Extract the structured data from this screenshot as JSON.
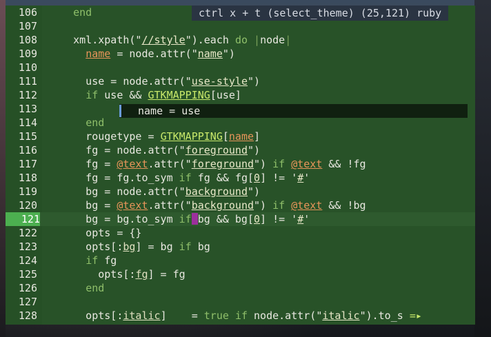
{
  "status": {
    "text": "ctrl x + t (select_theme) (25,121) ruby"
  },
  "popup": {
    "text": "name = use"
  },
  "truncation_marker": "=▸",
  "current_line": 121,
  "colors": {
    "editor_bg": "#285228",
    "current_line_bg": "#2e5a2e",
    "current_line_number_bg": "#4caf50",
    "cursor": "#9c2f9c",
    "status_bg": "#2a3442",
    "popup_bg": "#102010"
  },
  "lines": [
    {
      "n": "106",
      "t": "    end"
    },
    {
      "n": "107",
      "t": ""
    },
    {
      "n": "108",
      "t": "    xml.xpath(\"//style\").each do |node|"
    },
    {
      "n": "109",
      "t": "      name = node.attr(\"name\")"
    },
    {
      "n": "110",
      "t": ""
    },
    {
      "n": "111",
      "t": "      use = node.attr(\"use-style\")"
    },
    {
      "n": "112",
      "t": "      if use && GTKMAPPING[use]"
    },
    {
      "n": "113",
      "t": ""
    },
    {
      "n": "114",
      "t": "      end"
    },
    {
      "n": "115",
      "t": "      rougetype = GTKMAPPING[name]"
    },
    {
      "n": "116",
      "t": "      fg = node.attr(\"foreground\")"
    },
    {
      "n": "117",
      "t": "      fg = @text.attr(\"foreground\") if @text && !fg"
    },
    {
      "n": "118",
      "t": "      fg = fg.to_sym if fg && fg[0] != '#'"
    },
    {
      "n": "119",
      "t": "      bg = node.attr(\"background\")"
    },
    {
      "n": "120",
      "t": "      bg = @text.attr(\"background\") if @text && !bg"
    },
    {
      "n": "121",
      "t": "      bg = bg.to_sym if bg && bg[0] != '#'"
    },
    {
      "n": "122",
      "t": "      opts = {}"
    },
    {
      "n": "123",
      "t": "      opts[:bg] = bg if bg"
    },
    {
      "n": "124",
      "t": "      if fg"
    },
    {
      "n": "125",
      "t": "        opts[:fg] = fg"
    },
    {
      "n": "126",
      "t": "      end"
    },
    {
      "n": "127",
      "t": ""
    },
    {
      "n": "128",
      "t": "      opts[:italic]    = true if node.attr(\"italic\").to_s "
    }
  ]
}
